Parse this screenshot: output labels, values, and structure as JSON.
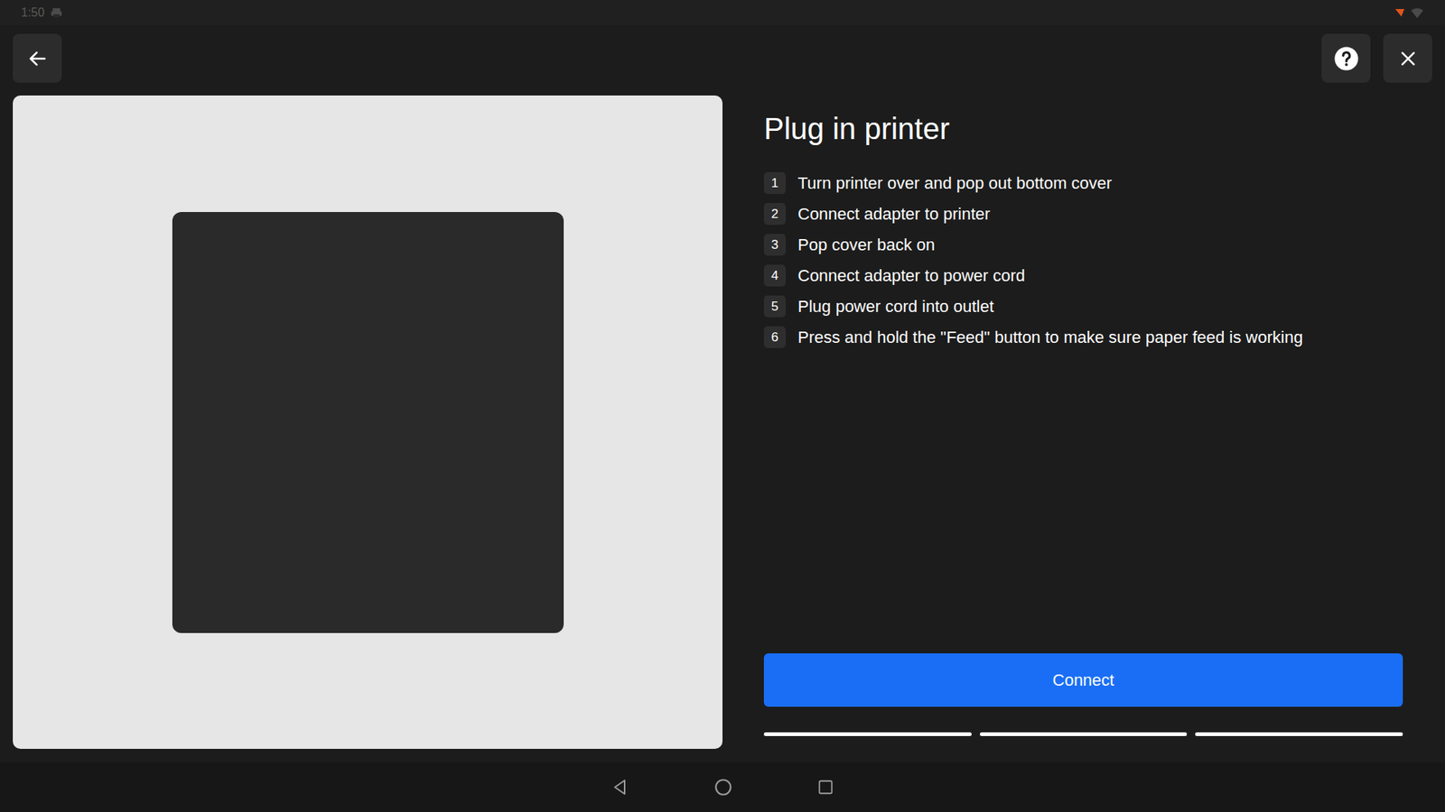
{
  "status_bar": {
    "time": "1:50"
  },
  "title": "Plug in printer",
  "steps": [
    {
      "number": "1",
      "text": "Turn printer over and pop out bottom cover"
    },
    {
      "number": "2",
      "text": "Connect adapter to printer"
    },
    {
      "number": "3",
      "text": "Pop cover back on"
    },
    {
      "number": "4",
      "text": "Connect adapter to power cord"
    },
    {
      "number": "5",
      "text": "Plug power cord into outlet"
    },
    {
      "number": "6",
      "text": "Press and hold the \"Feed\" button to make sure paper feed is working"
    }
  ],
  "primary_button": "Connect",
  "progress": [
    {
      "complete": true
    },
    {
      "complete": true
    },
    {
      "complete": true
    }
  ]
}
